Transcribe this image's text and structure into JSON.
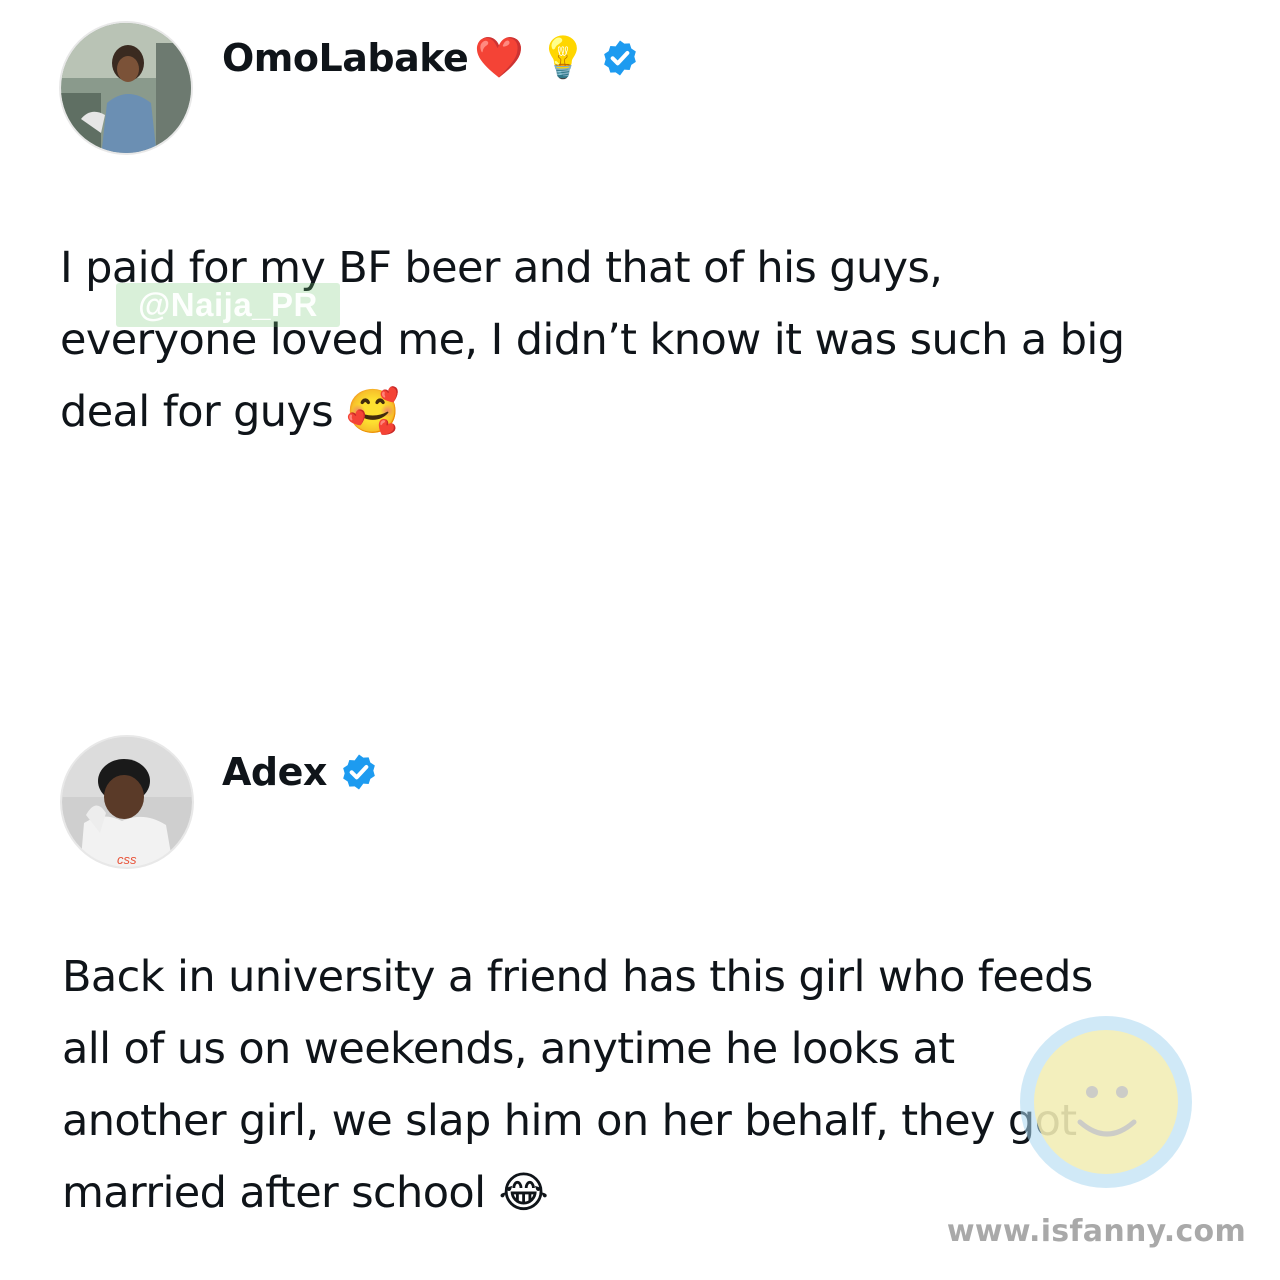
{
  "tweets": [
    {
      "display_name": "OmoLabake",
      "name_emojis": [
        "❤️",
        "💡"
      ],
      "avatar_icon": "user-avatar-photo",
      "verified_icon": "verified-badge-icon",
      "lines": [
        "I paid for my BF beer and that of his guys,",
        "everyone loved me, I didn’t know it was such a big",
        "deal for guys 🥰"
      ]
    },
    {
      "display_name": "Adex",
      "name_emojis": [],
      "avatar_icon": "user-avatar-photo",
      "verified_icon": "verified-badge-icon",
      "lines": [
        "Back in university a friend has this girl who feeds",
        "all of us on weekends, anytime he looks at",
        "another girl, we slap him on her behalf, they got",
        "married after school 😂"
      ]
    }
  ],
  "watermarks": {
    "handle": "@Naija_PR",
    "site": "www.isfanny.com"
  },
  "colors": {
    "verified_blue": "#1d9bf0",
    "text": "#0f1419"
  }
}
